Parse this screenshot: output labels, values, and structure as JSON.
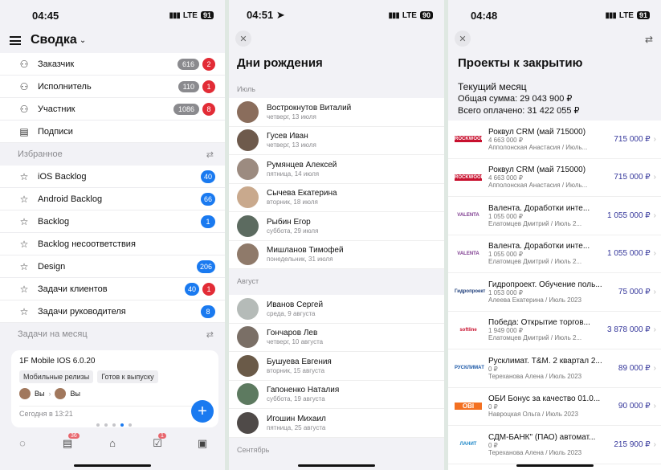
{
  "p1": {
    "time": "04:45",
    "lte": "LTE",
    "battery": "91",
    "title": "Сводка",
    "roles": [
      {
        "label": "Заказчик",
        "count": "616",
        "badge": "2"
      },
      {
        "label": "Исполнитель",
        "count": "110",
        "badge": "1"
      },
      {
        "label": "Участник",
        "count": "1086",
        "badge": "8"
      },
      {
        "label": "Подписи"
      }
    ],
    "fav_title": "Избранное",
    "favs": [
      {
        "label": "iOS Backlog",
        "blue": "40"
      },
      {
        "label": "Android Backlog",
        "blue": "66"
      },
      {
        "label": "Backlog",
        "blue": "1"
      },
      {
        "label": "Backlog несоответствия"
      },
      {
        "label": "Design",
        "blue": "206"
      },
      {
        "label": "Задачи клиентов",
        "blue": "40",
        "red": "1"
      },
      {
        "label": "Задачи руководителя",
        "blue": "8"
      }
    ],
    "month_title": "Задачи на месяц",
    "card": {
      "title": "1F Mobile IOS 6.0.20",
      "tag1": "Мобильные релизы",
      "tag2": "Готов к выпуску",
      "from": "Вы",
      "to": "Вы",
      "date": "Сегодня в 13:21"
    },
    "tab_badge1": "36",
    "tab_badge2": "1"
  },
  "p2": {
    "time": "04:51",
    "lte": "LTE",
    "battery": "90",
    "title": "Дни рождения",
    "m1": "Июль",
    "m2": "Август",
    "m3": "Сентябрь",
    "july": [
      {
        "n": "Вострокнутов Виталий",
        "d": "четверг, 13 июля"
      },
      {
        "n": "Гусев Иван",
        "d": "четверг, 13 июля"
      },
      {
        "n": "Румянцев Алексей",
        "d": "пятница, 14 июля"
      },
      {
        "n": "Сычева Екатерина",
        "d": "вторник, 18 июля"
      },
      {
        "n": "Рыбин Егор",
        "d": "суббота, 29 июля"
      },
      {
        "n": "Мишланов Тимофей",
        "d": "понедельник, 31 июля"
      }
    ],
    "aug": [
      {
        "n": "Иванов Сергей",
        "d": "среда, 9 августа"
      },
      {
        "n": "Гончаров Лев",
        "d": "четверг, 10 августа"
      },
      {
        "n": "Бушуева Евгения",
        "d": "вторник, 15 августа"
      },
      {
        "n": "Гапоненко Наталия",
        "d": "суббота, 19 августа"
      },
      {
        "n": "Игошин Михаил",
        "d": "пятница, 25 августа"
      }
    ]
  },
  "p3": {
    "time": "04:48",
    "lte": "LTE",
    "battery": "91",
    "title": "Проекты к закрытию",
    "cur": "Текущий месяц",
    "sum": "Общая сумма: 29 043 900 ₽",
    "paid": "Всего оплачено: 31 422 055 ₽",
    "items": [
      {
        "logo": "ROCKWOOL",
        "t": "Роквул CRM (май 715000)",
        "s": "4 663 000 ₽",
        "p": "Апполонская Анастасия / Июль...",
        "v": "715 000 ₽"
      },
      {
        "logo": "ROCKWOOL",
        "t": "Роквул CRM (май 715000)",
        "s": "4 663 000 ₽",
        "p": "Апполонская Анастасия / Июль...",
        "v": "715 000 ₽"
      },
      {
        "logo": "VALENTA",
        "t": "Валента. Доработки инте...",
        "s": "1 055 000 ₽",
        "p": "Елатомцев Дмитрий / Июль 2...",
        "v": "1 055 000 ₽"
      },
      {
        "logo": "VALENTA",
        "t": "Валента. Доработки инте...",
        "s": "1 055 000 ₽",
        "p": "Елатомцев Дмитрий / Июль 2...",
        "v": "1 055 000 ₽"
      },
      {
        "logo": "Гидропроект",
        "t": "Гидропроект. Обучение поль...",
        "s": "1 053 000 ₽",
        "p": "Алеева Екатерина / Июль 2023",
        "v": "75 000 ₽"
      },
      {
        "logo": "softline",
        "t": "Победа: Открытие торгов...",
        "s": "1 949 000 ₽",
        "p": "Елатомцев Дмитрий / Июль 2...",
        "v": "3 878 000 ₽"
      },
      {
        "logo": "РУСКЛИМАТ",
        "t": "Русклимат. T&M. 2 квартал 2...",
        "s": "0 ₽",
        "p": "Тереханова Алена / Июль 2023",
        "v": "89 000 ₽"
      },
      {
        "logo": "OBI",
        "t": "ОБИ Бонус за качество 01.0...",
        "s": "0 ₽",
        "p": "Навроцкая Ольга / Июль 2023",
        "v": "90 000 ₽"
      },
      {
        "logo": "ЛАНИТ",
        "t": "СДМ-БАНК\" (ПАО) автомат...",
        "s": "0 ₽",
        "p": "Тереханова Алена / Июль 2023",
        "v": "215 900 ₽"
      }
    ]
  }
}
